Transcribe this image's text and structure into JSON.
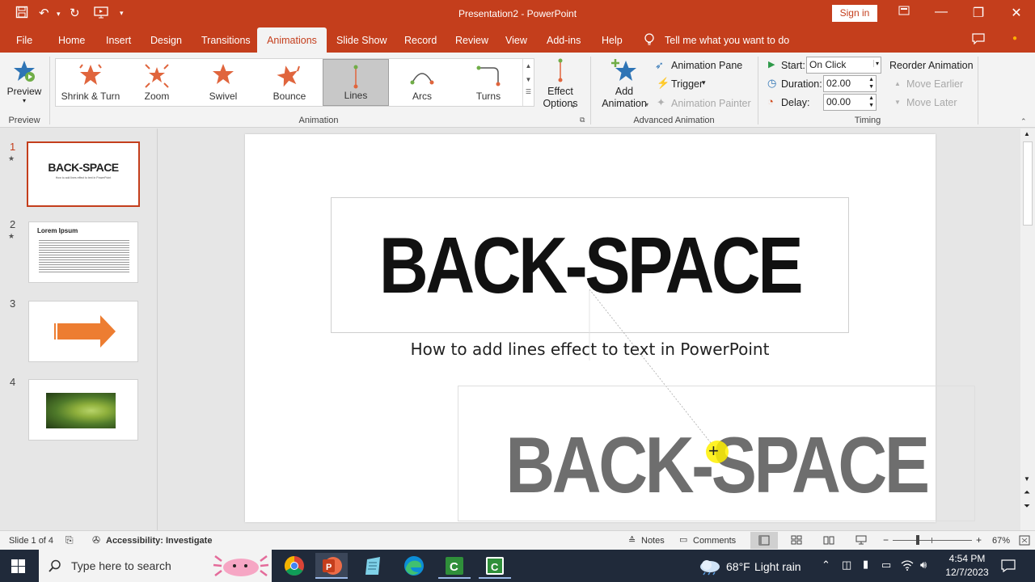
{
  "window": {
    "title": "Presentation2  -  PowerPoint",
    "signin": "Sign in"
  },
  "menu": [
    "File",
    "Home",
    "Insert",
    "Design",
    "Transitions",
    "Animations",
    "Slide Show",
    "Record",
    "Review",
    "View",
    "Add-ins",
    "Help"
  ],
  "tellme": "Tell me what you want to do",
  "ribbon": {
    "preview": {
      "label": "Preview",
      "group": "Preview"
    },
    "gallery": [
      "Shrink & Turn",
      "Zoom",
      "Swivel",
      "Bounce",
      "Lines",
      "Arcs",
      "Turns"
    ],
    "selected_effect": "Lines",
    "effect_options": [
      "Effect",
      "Options"
    ],
    "animation_group": "Animation",
    "add_animation": [
      "Add",
      "Animation"
    ],
    "animation_pane": "Animation Pane",
    "trigger": "Trigger",
    "animation_painter": "Animation Painter",
    "advanced_group": "Advanced Animation",
    "start_label": "Start:",
    "start_value": "On Click",
    "duration_label": "Duration:",
    "duration_value": "02.00",
    "delay_label": "Delay:",
    "delay_value": "00.00",
    "timing_group": "Timing",
    "reorder": "Reorder Animation",
    "move_earlier": "Move Earlier",
    "move_later": "Move Later"
  },
  "slides": [
    {
      "num": "1",
      "anim": true,
      "title": "BACK-SPACE",
      "sub": "How to add lines effect to text in PowerPoint"
    },
    {
      "num": "2",
      "anim": true,
      "title": "Lorem Ipsum"
    },
    {
      "num": "3",
      "anim": false
    },
    {
      "num": "4",
      "anim": false
    }
  ],
  "canvas": {
    "title": "BACK-SPACE",
    "subtitle": "How to add lines effect to text in PowerPoint",
    "ghost": "BACK-SPACE"
  },
  "status": {
    "slide": "Slide 1 of 4",
    "accessibility": "Accessibility: Investigate",
    "notes": "Notes",
    "comments": "Comments",
    "zoom": "67%"
  },
  "taskbar": {
    "search": "Type here to search",
    "weather_temp": "68°F",
    "weather_text": "Light rain",
    "time": "4:54 PM",
    "date": "12/7/2023"
  }
}
